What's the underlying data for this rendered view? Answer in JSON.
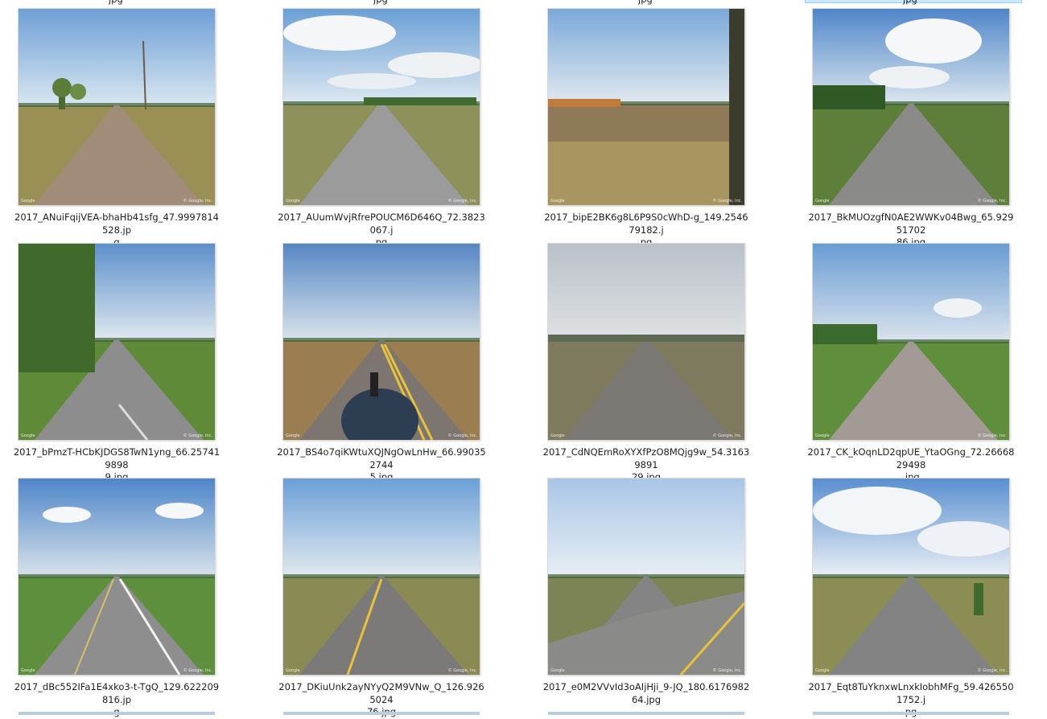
{
  "watermarks": {
    "left": "Google",
    "right": "© Google, Inc."
  },
  "top_row_partial": [
    "jpg",
    "jpg",
    "jpg",
    "jpg"
  ],
  "rows": [
    {
      "items": [
        {
          "line1": "2017_ANuiFqijVEA-bhaHb41sfg_47.9997814528.jp",
          "line2": "g",
          "scene": "dirt"
        },
        {
          "line1": "2017_AUumWvjRfrePOUCM6D646Q_72.3823067.j",
          "line2": "pg",
          "scene": "clouds"
        },
        {
          "line1": "2017_bipE2BK6g8L6P9S0cWhD-g_149.254679182.j",
          "line2": "pg",
          "scene": "field"
        },
        {
          "line1": "2017_BkMUOzgfN0AE2WWKv04Bwg_65.92951702",
          "line2": "86.jpg",
          "scene": "gravel-clouds"
        }
      ]
    },
    {
      "items": [
        {
          "line1": "2017_bPmzT-HCbKJDGS8TwN1yng_66.257419898",
          "line2": "9.jpg",
          "scene": "paved-trees"
        },
        {
          "line1": "2017_BS4o7qiKWtuXQJNgOwLnHw_66.990352744",
          "line2": "5.jpg",
          "scene": "paved-yellow"
        },
        {
          "line1": "2017_CdNQEmRoXYXfPzO8MQjg9w_54.31639891",
          "line2": "29.jpg",
          "scene": "overcast-dirt"
        },
        {
          "line1": "2017_CK_kOqnLD2qpUE_YtaOGng_72.2666829498",
          "line2": ".jpg",
          "scene": "gravel-green"
        }
      ]
    },
    {
      "items": [
        {
          "line1": "2017_dBc552IFa1E4xko3-t-TgQ_129.622209816.jp",
          "line2": "g",
          "scene": "paved-white"
        },
        {
          "line1": "2017_DKiuUnk2ayNYyQ2M9VNw_Q_126.9265024",
          "line2": "76.jpg",
          "scene": "paved-yellow-2"
        },
        {
          "line1": "2017_e0M2VVvId3oAIjHji_9-JQ_180.617698264.jpg",
          "line2": "",
          "scene": "diagonal-road"
        },
        {
          "line1": "2017_Eqt8TuYknxwLnxkIobhMFg_59.4265501752.j",
          "line2": "pg",
          "scene": "gravel-clouds-2"
        }
      ]
    }
  ]
}
